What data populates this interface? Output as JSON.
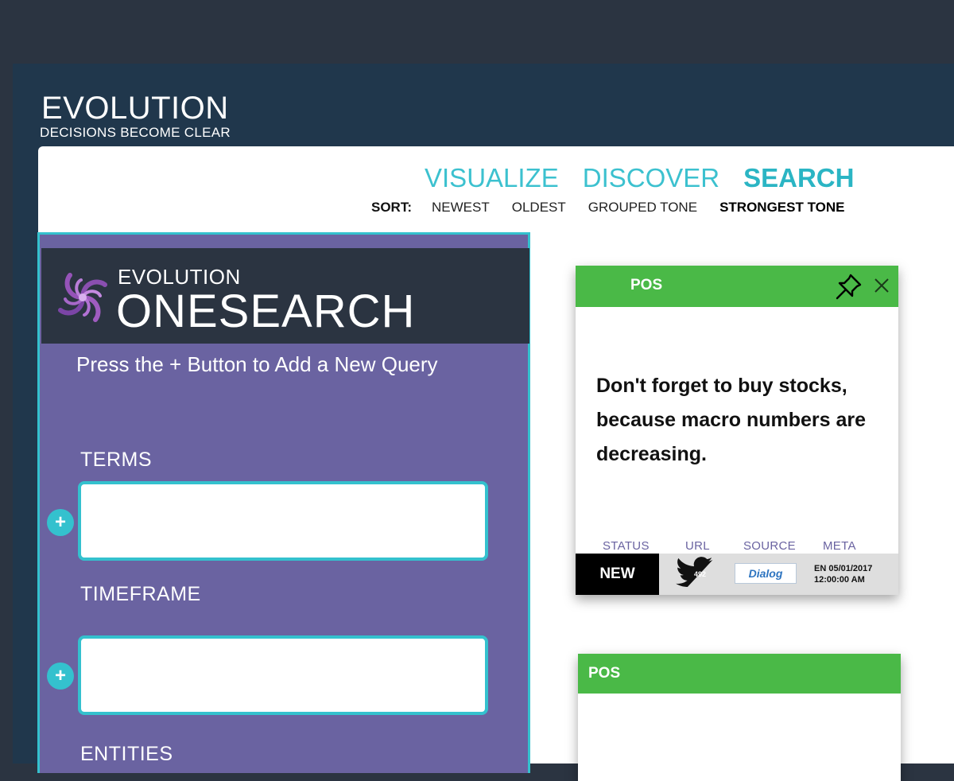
{
  "app": {
    "title": "EVOLUTION",
    "tagline": "DECISIONS BECOME CLEAR"
  },
  "nav": {
    "tabs": [
      {
        "label": "VISUALIZE",
        "active": false
      },
      {
        "label": "DISCOVER",
        "active": false
      },
      {
        "label": "SEARCH",
        "active": true
      }
    ]
  },
  "sort": {
    "label": "SORT:",
    "options": [
      {
        "label": "NEWEST",
        "active": false
      },
      {
        "label": "OLDEST",
        "active": false
      },
      {
        "label": "GROUPED TONE",
        "active": false
      },
      {
        "label": "STRONGEST TONE",
        "active": true
      }
    ]
  },
  "onesearch": {
    "brand": "EVOLUTION",
    "product": "ONESEARCH",
    "instruction": "Press the + Button to Add a New Query",
    "add_label": "+",
    "fields": [
      {
        "label": "TERMS",
        "value": "",
        "placeholder": ""
      },
      {
        "label": "TIMEFRAME",
        "value": "",
        "placeholder": ""
      },
      {
        "label": "ENTITIES"
      }
    ]
  },
  "cards": [
    {
      "tag": "POS",
      "text": "Don't forget to buy stocks, because macro numbers are decreasing.",
      "meta_labels": {
        "status": "STATUS",
        "url": "URL",
        "source": "SOURCE",
        "meta": "META"
      },
      "status": "NEW",
      "url_count": "492",
      "source_name": "Dialog",
      "meta_line1": "EN 05/01/2017",
      "meta_line2": "12:00:00 AM"
    },
    {
      "tag": "POS"
    }
  ],
  "colors": {
    "accent_teal": "#34c1ce",
    "panel_purple": "#6a63a1",
    "positive_green": "#4ab947",
    "header_navy": "#20374c"
  },
  "icons": {
    "logo": "swirl-logo-icon",
    "pin": "pin-icon",
    "close": "close-icon",
    "url": "twitter-icon",
    "add": "plus-icon"
  }
}
